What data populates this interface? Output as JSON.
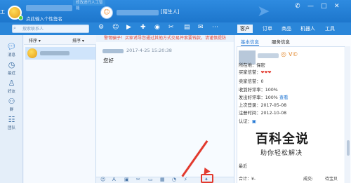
{
  "header": {
    "edge_char": "工",
    "signature": "点此输入个性签名",
    "ghost_tab": "修改进行人工智能",
    "contact_tag": "[陌生人]",
    "win_controls": [
      "✆",
      "—",
      "□",
      "✕"
    ]
  },
  "toolbar": {
    "search_placeholder": "搜索联系人",
    "notice": "警惕骗子！买家诱导您通过其他方式交易并索要钱款，请谨慎提防",
    "right_tabs": [
      "客户",
      "订单",
      "商品",
      "机器人",
      "工具"
    ]
  },
  "nav": {
    "items": [
      {
        "label": "消息",
        "icon": "chat-bubble-icon"
      },
      {
        "label": "最近",
        "icon": "clock-icon"
      },
      {
        "label": "好友",
        "icon": "person-icon"
      },
      {
        "label": "群",
        "icon": "group-icon"
      },
      {
        "label": "团队",
        "icon": "team-icon"
      }
    ]
  },
  "session_list": {
    "sort_left": "排序 ▾",
    "sort_right": "排序 ▾"
  },
  "chat": {
    "message_time": "2017-4-25 15:20:38",
    "message_text": "您好"
  },
  "right_panel": {
    "tabs": [
      "基本信息",
      "服务信息"
    ],
    "info": {
      "location": "所在地：保密",
      "buyer_credit_label": "买家信誉：",
      "hearts": "❤❤❤",
      "seller_credit": "卖家信誉：0",
      "positive_received": "收到好评率：100%",
      "positive_given": "发出好评率：100%",
      "view_link": "查看",
      "last_login": "上次登录：2017-05-08",
      "register_time": "注册时间：2012-10-08",
      "verify": "认证："
    },
    "tail": {
      "recent_label": "最近",
      "amount_label": "合计：¥-",
      "deal_label": "成交:",
      "deal_suffix": "待宝贝"
    },
    "badge_vc": "V©"
  },
  "watermark": {
    "logo": "百科全说",
    "sub": "助你轻松解决"
  },
  "colors": {
    "header_blue": "#2a86d9",
    "accent_red": "#e23a2e",
    "link_blue": "#1e74d2"
  }
}
